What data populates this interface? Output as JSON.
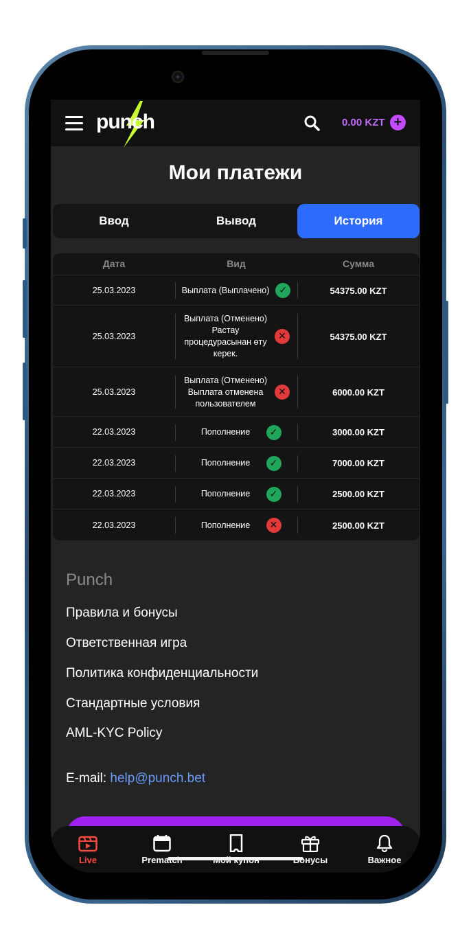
{
  "header": {
    "brand": "punch",
    "balance": "0.00 KZT",
    "add_symbol": "+"
  },
  "page": {
    "title": "Мои платежи"
  },
  "tabs": [
    {
      "label": "Ввод",
      "active": false
    },
    {
      "label": "Вывод",
      "active": false
    },
    {
      "label": "История",
      "active": true
    }
  ],
  "table": {
    "headers": [
      "Дата",
      "Вид",
      "Сумма"
    ],
    "rows": [
      {
        "date": "25.03.2023",
        "type": "Выплата (Выплачено)",
        "status": "success",
        "amount": "54375.00 KZT"
      },
      {
        "date": "25.03.2023",
        "type": "Выплата (Отменено) Растау процедурасынан өту керек.",
        "status": "error",
        "amount": "54375.00 KZT"
      },
      {
        "date": "25.03.2023",
        "type": "Выплата (Отменено) Выплата отменена пользователем",
        "status": "error",
        "amount": "6000.00 KZT"
      },
      {
        "date": "22.03.2023",
        "type": "Пополнение",
        "status": "success",
        "amount": "3000.00 KZT"
      },
      {
        "date": "22.03.2023",
        "type": "Пополнение",
        "status": "success",
        "amount": "7000.00 KZT"
      },
      {
        "date": "22.03.2023",
        "type": "Пополнение",
        "status": "success",
        "amount": "2500.00 KZT"
      },
      {
        "date": "22.03.2023",
        "type": "Пополнение",
        "status": "error",
        "amount": "2500.00 KZT"
      }
    ]
  },
  "footer": {
    "title": "Punch",
    "links": [
      "Правила и бонусы",
      "Ответственная игра",
      "Политика конфиденциальности",
      "Стандартные условия",
      "AML-KYC Policy"
    ],
    "email_label": "E-mail: ",
    "email": "help@punch.bet"
  },
  "bottom_nav": [
    {
      "label": "Live",
      "icon": "live-icon",
      "active": true
    },
    {
      "label": "Prematch",
      "icon": "calendar-icon",
      "active": false
    },
    {
      "label": "Мой купон",
      "icon": "coupon-icon",
      "active": false
    },
    {
      "label": "Бонусы",
      "icon": "gift-icon",
      "active": false
    },
    {
      "label": "Важное",
      "icon": "bell-icon",
      "active": false
    }
  ],
  "colors": {
    "accent_blue": "#2d6bff",
    "balance_purple": "#c46bff",
    "success": "#1fa65a",
    "error": "#e23a3a",
    "live_red": "#ff4a3d",
    "logo_bolt": "#c8ff2e"
  }
}
